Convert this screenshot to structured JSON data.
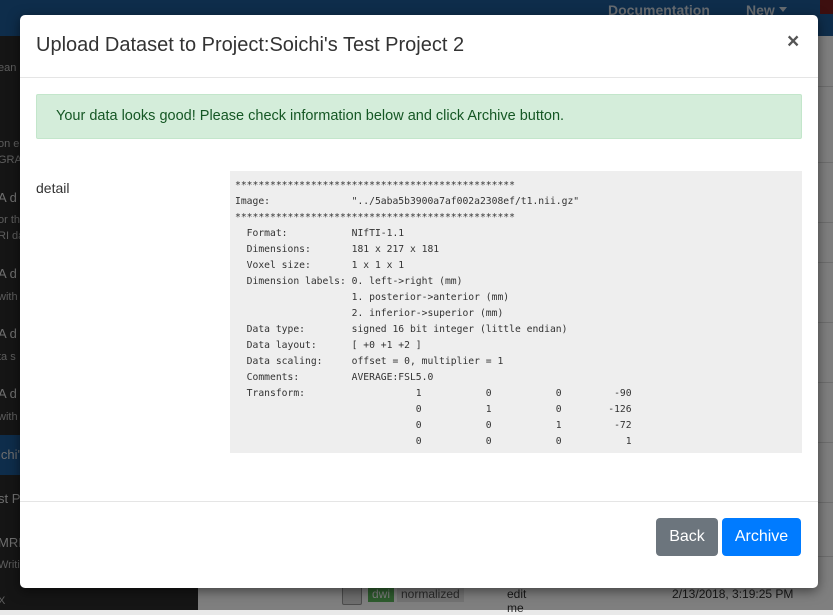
{
  "background": {
    "nav": {
      "documentation": "Documentation",
      "new": "New"
    },
    "sidebar": [
      "ean",
      "on e",
      "GRA",
      "A d",
      "or th",
      "RI da",
      "A d",
      "with",
      "A d",
      "ta s",
      "A d",
      "with",
      "ichi's",
      "st P",
      "MRI",
      "Writi",
      "X"
    ],
    "row": {
      "tag": "dwi",
      "type": "normalized",
      "desc": "edit me",
      "date": "2/13/2018, 3:19:25 PM"
    }
  },
  "modal": {
    "title": "Upload Dataset to Project:Soichi's Test Project 2",
    "close": "×",
    "alert": "Your data looks good! Please check information below and click Archive button.",
    "detail_label": "detail",
    "detail_text": "************************************************\nImage:              \"../5aba5b3900a7af002a2308ef/t1.nii.gz\"\n************************************************\n  Format:           NIfTI-1.1\n  Dimensions:       181 x 217 x 181\n  Voxel size:       1 x 1 x 1\n  Dimension labels: 0. left->right (mm)\n                    1. posterior->anterior (mm)\n                    2. inferior->superior (mm)\n  Data type:        signed 16 bit integer (little endian)\n  Data layout:      [ +0 +1 +2 ]\n  Data scaling:     offset = 0, multiplier = 1\n  Comments:         AVERAGE:FSL5.0\n  Transform:                   1           0           0         -90\n                               0           1           0        -126\n                               0           0           1         -72\n                               0           0           0           1",
    "buttons": {
      "back": "Back",
      "archive": "Archive"
    }
  }
}
